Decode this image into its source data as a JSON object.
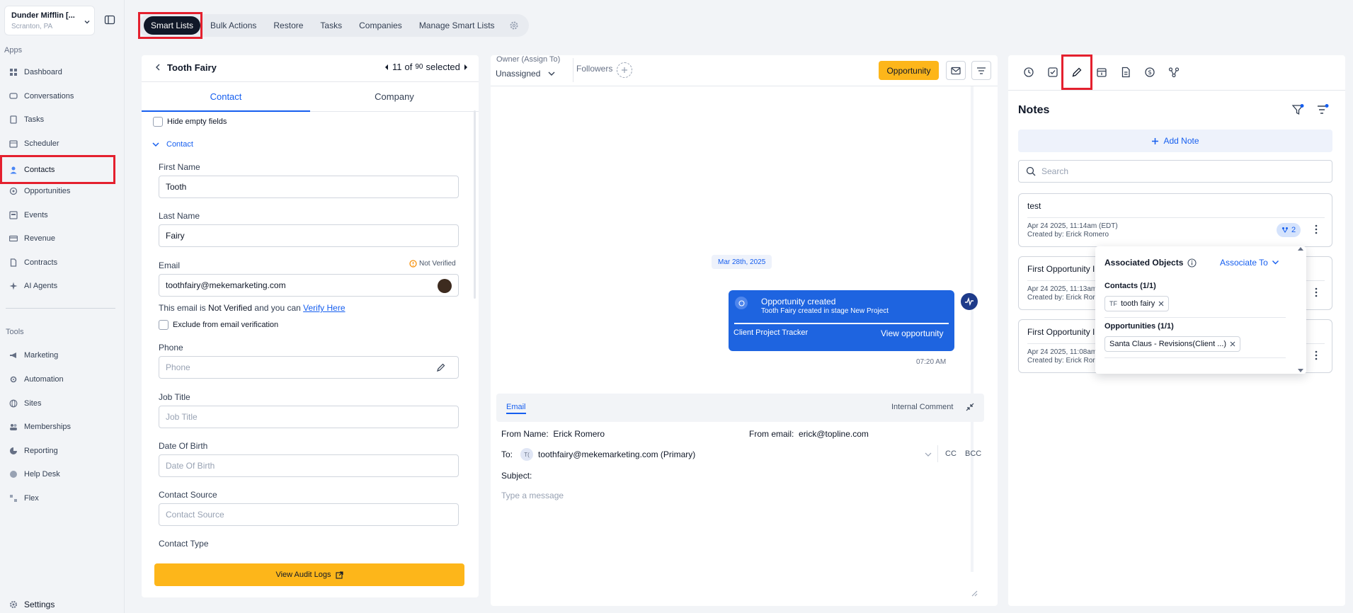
{
  "account": {
    "name": "Dunder Mifflin [...",
    "location": "Scranton, PA"
  },
  "sidebar": {
    "apps_label": "Apps",
    "apps": [
      {
        "label": "Dashboard",
        "icon": "dashboard-icon"
      },
      {
        "label": "Conversations",
        "icon": "chat-icon"
      },
      {
        "label": "Tasks",
        "icon": "task-icon"
      },
      {
        "label": "Scheduler",
        "icon": "calendar-icon"
      },
      {
        "label": "Contacts",
        "icon": "person-icon"
      },
      {
        "label": "Opportunities",
        "icon": "target-icon"
      },
      {
        "label": "Events",
        "icon": "event-icon"
      },
      {
        "label": "Revenue",
        "icon": "card-icon"
      },
      {
        "label": "Contracts",
        "icon": "document-icon"
      },
      {
        "label": "AI Agents",
        "icon": "sparkle-icon"
      }
    ],
    "tools_label": "Tools",
    "tools": [
      {
        "label": "Marketing",
        "icon": "megaphone-icon"
      },
      {
        "label": "Automation",
        "icon": "automation-icon"
      },
      {
        "label": "Sites",
        "icon": "globe-icon"
      },
      {
        "label": "Memberships",
        "icon": "members-icon"
      },
      {
        "label": "Reporting",
        "icon": "chart-icon"
      },
      {
        "label": "Help Desk",
        "icon": "help-icon"
      },
      {
        "label": "Flex",
        "icon": "flex-icon"
      }
    ],
    "settings_label": "Settings"
  },
  "topbar": {
    "tabs": [
      "Smart Lists",
      "Bulk Actions",
      "Restore",
      "Tasks",
      "Companies",
      "Manage Smart Lists"
    ]
  },
  "contact": {
    "name": "Tooth Fairy",
    "current": "11",
    "of_label": "of",
    "total": "90",
    "selected_label": "selected",
    "tabs": [
      "Contact",
      "Company"
    ],
    "hide_empty": "Hide empty fields",
    "section": "Contact",
    "first_name_label": "First Name",
    "first_name": "Tooth",
    "last_name_label": "Last Name",
    "last_name": "Fairy",
    "email_label": "Email",
    "not_verified": "Not Verified",
    "email": "toothfairy@mekemarketing.com",
    "verify_prefix": "This email is",
    "verify_status": "Not Verified",
    "verify_mid": "and you can",
    "verify_link": "Verify Here",
    "exclude_label": "Exclude from email verification",
    "phone_label": "Phone",
    "phone_ph": "Phone",
    "job_label": "Job Title",
    "job_ph": "Job Title",
    "dob_label": "Date Of Birth",
    "dob_ph": "Date Of Birth",
    "source_label": "Contact Source",
    "source_ph": "Contact Source",
    "type_label": "Contact Type",
    "audit_button": "View Audit Logs"
  },
  "conversation": {
    "owner_label": "Owner (Assign To)",
    "owner_value": "Unassigned",
    "followers_label": "Followers",
    "opportunity_button": "Opportunity",
    "date_chip": "Mar 28th, 2025",
    "card_title": "Opportunity created",
    "card_subtitle": "Tooth Fairy created in stage New Project",
    "card_pipeline": "Client Project Tracker",
    "card_link": "View opportunity",
    "card_time": "07:20 AM",
    "compose_tab": "Email",
    "internal_comment": "Internal Comment",
    "from_name_label": "From Name:",
    "from_name": "Erick Romero",
    "from_email_label": "From email:",
    "from_email": "erick@topline.com",
    "to_label": "To:",
    "to_initials": "T(",
    "to_value": "toothfairy@mekemarketing.com (Primary)",
    "cc": "CC",
    "bcc": "BCC",
    "subject_label": "Subject:",
    "message_ph": "Type a message"
  },
  "notes": {
    "title": "Notes",
    "add_note": "Add Note",
    "search_ph": "Search",
    "items": [
      {
        "title": "test",
        "date": "Apr 24 2025, 11:14am (EDT)",
        "author": "Created by: Erick Romero",
        "assoc_count": "2"
      },
      {
        "title": "First Opportunity I",
        "date": "Apr 24 2025, 11:13am",
        "author": "Created by: Erick Ror"
      },
      {
        "title": "First Opportunity I",
        "date": "Apr 24 2025, 11:08am",
        "author": "Created by: Erick Ror"
      }
    ],
    "popover": {
      "title": "Associated Objects",
      "associate_to": "Associate To",
      "contacts_label": "Contacts (1/1)",
      "contact_initials": "TF",
      "contact_name": "tooth fairy",
      "opps_label": "Opportunities (1/1)",
      "opp_name": "Santa Claus - Revisions(Client ...)"
    }
  },
  "colors": {
    "accent": "#155eef",
    "highlight": "#e4202e",
    "opportunity": "#fdb61a",
    "card_blue": "#1e64e0",
    "dark": "#101828"
  }
}
